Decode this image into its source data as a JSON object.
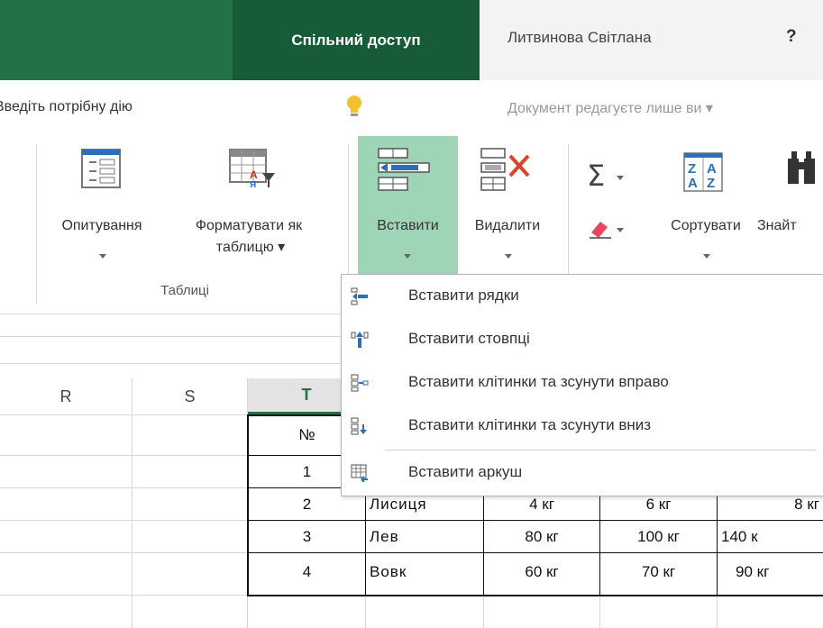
{
  "titlebar": {
    "share_tab": "Спільний доступ",
    "user_name": "Литвинова Світлана",
    "help": "?"
  },
  "tellbar": {
    "tell_me": "Введіть потрібну дію",
    "readonly_note": "Документ редагуєте лише ви ▾"
  },
  "ribbon": {
    "survey": "Опитування",
    "format_table_line1": "Форматувати як",
    "format_table_line2": "таблицю ▾",
    "group_tables": "Таблиці",
    "insert": "Вставити",
    "delete": "Видалити",
    "sort_line1": "Сортувати",
    "find": "Знайт"
  },
  "insert_menu": [
    {
      "icon": "insert-rows-icon",
      "label": "Вставити рядки"
    },
    {
      "icon": "insert-columns-icon",
      "label": "Вставити стовпці"
    },
    {
      "icon": "insert-cells-right-icon",
      "label": "Вставити клітинки та зсунути вправо"
    },
    {
      "icon": "insert-cells-down-icon",
      "label": "Вставити клітинки та зсунути вниз"
    },
    {
      "icon": "insert-sheet-icon",
      "label": "Вставити аркуш"
    }
  ],
  "grid": {
    "columns": [
      "R",
      "S",
      "T"
    ],
    "header_no": "№",
    "rows": [
      {
        "no": "1",
        "name": "",
        "c1": "",
        "c2": "",
        "c3": ""
      },
      {
        "no": "2",
        "name": "Лисиця",
        "c1": "4 кг",
        "c2": "6 кг",
        "c3": "8 кг"
      },
      {
        "no": "3",
        "name": "Лев",
        "c1": "80 кг",
        "c2": "100 кг",
        "c3": "140 к"
      },
      {
        "no": "4",
        "name": "Вовк",
        "c1": "60 кг",
        "c2": "70 кг",
        "c3": "90 кг"
      }
    ]
  },
  "colors": {
    "title_green": "#217346",
    "share_green": "#185c37",
    "insert_selected": "#9fd5b7",
    "active_col_header": "#217346"
  }
}
